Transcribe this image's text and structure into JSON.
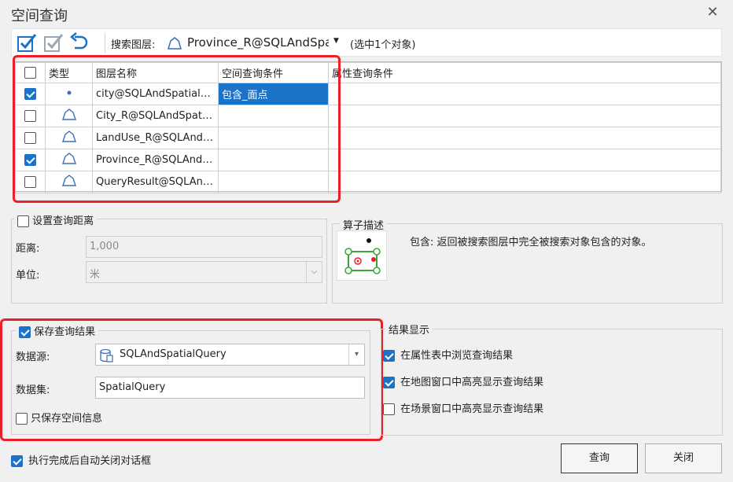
{
  "window": {
    "title": "空间查询"
  },
  "toolbar": {
    "search_layer_label": "搜索图层:",
    "search_layer_value": "Province_R@SQLAndSpa",
    "selection_count": "(选中1个对象)"
  },
  "grid": {
    "headers": [
      "类型",
      "图层名称",
      "空间查询条件",
      "属性查询条件"
    ],
    "rows": [
      {
        "checked": true,
        "type_icon": "point-icon",
        "name": "city@SQLAndSpatialQ...",
        "spatial": "包含_面点",
        "attr": ""
      },
      {
        "checked": false,
        "type_icon": "region-icon",
        "name": "City_R@SQLAndSpatial...",
        "spatial": "",
        "attr": ""
      },
      {
        "checked": false,
        "type_icon": "region-icon",
        "name": "LandUse_R@SQLAndS...",
        "spatial": "",
        "attr": ""
      },
      {
        "checked": true,
        "type_icon": "region-icon",
        "name": "Province_R@SQLAndS...",
        "spatial": "",
        "attr": ""
      },
      {
        "checked": false,
        "type_icon": "region-icon",
        "name": "QueryResult@SQLAnd...",
        "spatial": "",
        "attr": ""
      }
    ]
  },
  "distance": {
    "title": "设置查询距离",
    "distance_label": "距离:",
    "distance_value": "1,000",
    "unit_label": "单位:",
    "unit_value": "米"
  },
  "operator": {
    "title": "算子描述",
    "description": "包含: 返回被搜索图层中完全被搜索对象包含的对象。"
  },
  "save": {
    "title": "保存查询结果",
    "datasource_label": "数据源:",
    "datasource_value": "SQLAndSpatialQuery",
    "dataset_label": "数据集:",
    "dataset_value": "SpatialQuery",
    "spatial_only_label": "只保存空间信息"
  },
  "display": {
    "title": "结果显示",
    "opt1": "在属性表中浏览查询结果",
    "opt2": "在地图窗口中高亮显示查询结果",
    "opt3": "在场景窗口中高亮显示查询结果"
  },
  "footer": {
    "autoclose_label": "执行完成后自动关闭对话框",
    "query_button": "查询",
    "close_button": "关闭"
  },
  "colors": {
    "accent": "#1a73c8",
    "highlight_box": "#e8202a"
  }
}
